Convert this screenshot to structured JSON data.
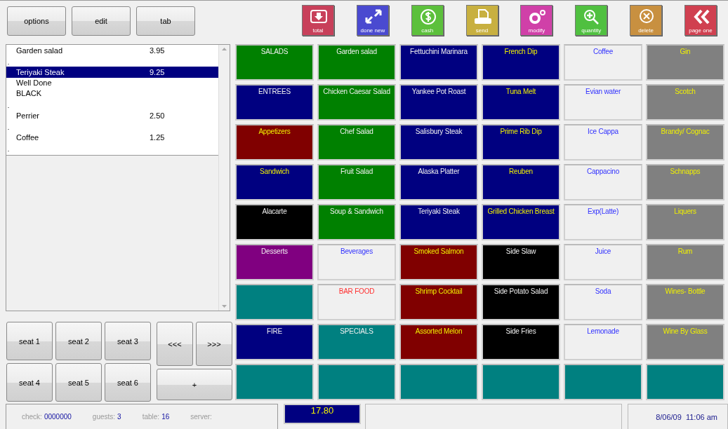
{
  "top_buttons": [
    "options",
    "edit",
    "tab"
  ],
  "toolbar": [
    {
      "label": "total",
      "kind": "total",
      "color": "#c8405a"
    },
    {
      "label": "done new",
      "kind": "done",
      "color": "#4a4ad0"
    },
    {
      "label": "cash",
      "kind": "cash",
      "color": "#5cc03c"
    },
    {
      "label": "send",
      "kind": "send",
      "color": "#c8b040"
    },
    {
      "label": "modify",
      "kind": "modify",
      "color": "#d040a8"
    },
    {
      "label": "quantity",
      "kind": "quantity",
      "color": "#50c040"
    },
    {
      "label": "delete",
      "kind": "delete",
      "color": "#c89040"
    },
    {
      "label": "page one",
      "kind": "page",
      "color": "#d04050"
    }
  ],
  "order": [
    {
      "name": "Garden salad",
      "price": "3.95",
      "selected": false
    },
    {
      "name": "Teriyaki Steak",
      "price": "9.25",
      "selected": true,
      "modifiers": [
        "Well Done",
        "BLACK"
      ]
    },
    {
      "name": "Perrier",
      "price": "2.50",
      "selected": false
    },
    {
      "name": "Coffee",
      "price": "1.25",
      "selected": false
    }
  ],
  "seats": [
    "seat  1",
    "seat  2",
    "seat  3",
    "seat  4",
    "seat  5",
    "seat  6"
  ],
  "nav": {
    "prev": "<<<",
    "next": ">>>",
    "add": "+"
  },
  "tiles": [
    [
      {
        "label": "SALADS",
        "color": "#008000",
        "kind": "light"
      },
      {
        "label": "Garden salad",
        "color": "#008000",
        "kind": "light"
      },
      {
        "label": "Fettuchini Marinara",
        "color": "#000080",
        "kind": "light"
      },
      {
        "label": "French Dip",
        "color": "#000080",
        "kind": "yellow"
      },
      {
        "label": "Coffee",
        "color": "#f0f0f0",
        "kind": "blue"
      },
      {
        "label": "Gin",
        "color": "#808080",
        "kind": "yellow"
      }
    ],
    [
      {
        "label": "ENTREES",
        "color": "#000080",
        "kind": "light"
      },
      {
        "label": "Chicken Caesar Salad",
        "color": "#008000",
        "kind": "light"
      },
      {
        "label": "Yankee Pot Roast",
        "color": "#000080",
        "kind": "light"
      },
      {
        "label": "Tuna Melt",
        "color": "#000080",
        "kind": "yellow"
      },
      {
        "label": "Evian water",
        "color": "#f0f0f0",
        "kind": "blue"
      },
      {
        "label": "Scotch",
        "color": "#808080",
        "kind": "yellow"
      }
    ],
    [
      {
        "label": "Appetizers",
        "color": "#800000",
        "kind": "yellow"
      },
      {
        "label": "Chef Salad",
        "color": "#008000",
        "kind": "light"
      },
      {
        "label": "Salisbury Steak",
        "color": "#000080",
        "kind": "light"
      },
      {
        "label": "Prime Rib Dip",
        "color": "#000080",
        "kind": "yellow"
      },
      {
        "label": "Ice Cappa",
        "color": "#f0f0f0",
        "kind": "blue"
      },
      {
        "label": "Brandy/ Cognac",
        "color": "#808080",
        "kind": "yellow"
      }
    ],
    [
      {
        "label": "Sandwich",
        "color": "#000080",
        "kind": "yellow"
      },
      {
        "label": "Fruit Salad",
        "color": "#008000",
        "kind": "light"
      },
      {
        "label": "Alaska Platter",
        "color": "#000080",
        "kind": "light"
      },
      {
        "label": "Reuben",
        "color": "#000080",
        "kind": "yellow"
      },
      {
        "label": "Cappacino",
        "color": "#f0f0f0",
        "kind": "blue"
      },
      {
        "label": "Schnapps",
        "color": "#808080",
        "kind": "yellow"
      }
    ],
    [
      {
        "label": "Alacarte",
        "color": "#000000",
        "kind": "light"
      },
      {
        "label": "Soup & Sandwich",
        "color": "#008000",
        "kind": "light"
      },
      {
        "label": "Teriyaki Steak",
        "color": "#000080",
        "kind": "light"
      },
      {
        "label": "Grilled Chicken Breast",
        "color": "#000080",
        "kind": "yellow"
      },
      {
        "label": "Exp(Latte)",
        "color": "#f0f0f0",
        "kind": "blue"
      },
      {
        "label": "Liquers",
        "color": "#808080",
        "kind": "yellow"
      }
    ],
    [
      {
        "label": "Desserts",
        "color": "#800080",
        "kind": "light"
      },
      {
        "label": "Beverages",
        "color": "#f0f0f0",
        "kind": "blue"
      },
      {
        "label": "Smoked Salmon",
        "color": "#800000",
        "kind": "yellow"
      },
      {
        "label": "Side Slaw",
        "color": "#000000",
        "kind": "light"
      },
      {
        "label": "Juice",
        "color": "#f0f0f0",
        "kind": "blue"
      },
      {
        "label": "Rum",
        "color": "#808080",
        "kind": "yellow"
      }
    ],
    [
      {
        "color": "#008080"
      },
      {
        "label": "BAR FOOD",
        "color": "#f0f0f0",
        "kind": "red"
      },
      {
        "label": "Shrimp Cocktail",
        "color": "#800000",
        "kind": "yellow"
      },
      {
        "label": "Side Potato Salad",
        "color": "#000000",
        "kind": "light"
      },
      {
        "label": "Soda",
        "color": "#f0f0f0",
        "kind": "blue"
      },
      {
        "label": "Wines- Bottle",
        "color": "#808080",
        "kind": "yellow"
      }
    ],
    [
      {
        "label": "FIRE",
        "color": "#000080",
        "kind": "light"
      },
      {
        "label": "SPECIALS",
        "color": "#008080",
        "kind": "light"
      },
      {
        "label": "Assorted Melon",
        "color": "#800000",
        "kind": "yellow"
      },
      {
        "label": "Side Fries",
        "color": "#000000",
        "kind": "light"
      },
      {
        "label": "Lemonade",
        "color": "#f0f0f0",
        "kind": "blue"
      },
      {
        "label": "Wine By Glass",
        "color": "#808080",
        "kind": "yellow"
      }
    ],
    [
      {
        "color": "#008080"
      },
      {
        "color": "#008080"
      },
      {
        "color": "#008080"
      },
      {
        "color": "#008080"
      },
      {
        "color": "#008080"
      },
      {
        "color": "#008080"
      }
    ]
  ],
  "status": {
    "fields": [
      {
        "label": "check:",
        "value": "0000000"
      },
      {
        "label": "guests:",
        "value": "3"
      },
      {
        "label": "table:",
        "value": "16"
      },
      {
        "label": "server:"
      }
    ],
    "total": "17.80",
    "datetime": "8/06/09  11:06 am"
  }
}
